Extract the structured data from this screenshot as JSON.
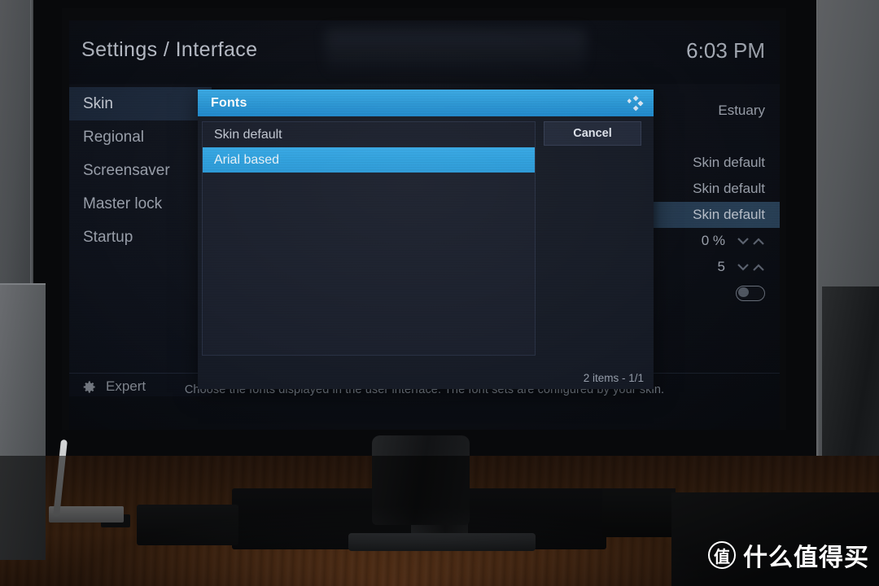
{
  "header": {
    "title": "Settings / Interface",
    "clock": "6:03 PM"
  },
  "sidebar": {
    "items": [
      {
        "label": "Skin",
        "selected": true
      },
      {
        "label": "Regional",
        "selected": false
      },
      {
        "label": "Screensaver",
        "selected": false
      },
      {
        "label": "Master lock",
        "selected": false
      },
      {
        "label": "Startup",
        "selected": false
      }
    ],
    "level": {
      "label": "Expert",
      "icon": "gear-icon"
    }
  },
  "settings_values": [
    {
      "value": "Estuary",
      "control": "text",
      "highlighted": false
    },
    {
      "value": "",
      "control": "none",
      "highlighted": false
    },
    {
      "value": "Skin default",
      "control": "text",
      "highlighted": false
    },
    {
      "value": "Skin default",
      "control": "text",
      "highlighted": false
    },
    {
      "value": "Skin default",
      "control": "text",
      "highlighted": true
    },
    {
      "value": "0 %",
      "control": "spinner",
      "highlighted": false
    },
    {
      "value": "5",
      "control": "spinner",
      "highlighted": false
    },
    {
      "value": "",
      "control": "toggle",
      "toggle_state": "off",
      "highlighted": false
    }
  ],
  "help": {
    "text": "Choose the fonts displayed in the user interface. The font sets are configured by your skin."
  },
  "dialog": {
    "title": "Fonts",
    "logo": "kodi-logo-icon",
    "cancel_label": "Cancel",
    "count_label": "2 items - 1/1",
    "items": [
      {
        "label": "Skin default",
        "selected": false
      },
      {
        "label": "Arial based",
        "selected": true
      }
    ]
  },
  "watermark": {
    "badge": "值",
    "text": "什么值得买"
  },
  "colors": {
    "accent_blue": "#2ea0dd",
    "titlebar_blue": "#2a96d4",
    "panel_dark": "#1a1f2c",
    "screen_bg": "#0d1016",
    "text_primary": "#c3c9d3",
    "text_muted": "#9aa0ab",
    "highlight_row": "#2a4259"
  }
}
